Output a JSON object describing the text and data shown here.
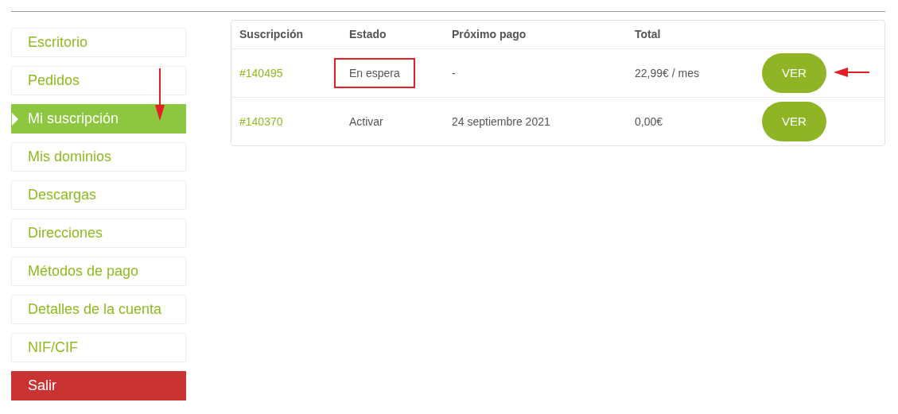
{
  "menu": [
    {
      "label": "Escritorio",
      "kind": "link",
      "selected": false,
      "arrow": false
    },
    {
      "label": "Pedidos",
      "kind": "link",
      "selected": false,
      "arrow": false
    },
    {
      "label": "Mi suscripción",
      "kind": "link",
      "selected": true,
      "arrow": true
    },
    {
      "label": "Mis dominios",
      "kind": "link",
      "selected": false,
      "arrow": false
    },
    {
      "label": "Descargas",
      "kind": "link",
      "selected": false,
      "arrow": false
    },
    {
      "label": "Direcciones",
      "kind": "link",
      "selected": false,
      "arrow": false
    },
    {
      "label": "Métodos de pago",
      "kind": "link",
      "selected": false,
      "arrow": false
    },
    {
      "label": "Detalles de la cuenta",
      "kind": "link",
      "selected": false,
      "arrow": false
    },
    {
      "label": "NIF/CIF",
      "kind": "link",
      "selected": false,
      "arrow": false
    },
    {
      "label": "Salir",
      "kind": "logout",
      "selected": false,
      "arrow": false
    }
  ],
  "table": {
    "columns": [
      "Suscripción",
      "Estado",
      "Próximo pago",
      "Total"
    ],
    "rows": [
      {
        "id": "#140495",
        "status": "En espera",
        "status_highlighted": true,
        "next_payment": "-",
        "total": "22,99€ / mes",
        "button": "VER",
        "arrow": true
      },
      {
        "id": "#140370",
        "status": "Activar",
        "status_highlighted": false,
        "next_payment": "24 septiembre 2021",
        "total": "0,00€",
        "button": "VER",
        "arrow": false
      }
    ]
  }
}
